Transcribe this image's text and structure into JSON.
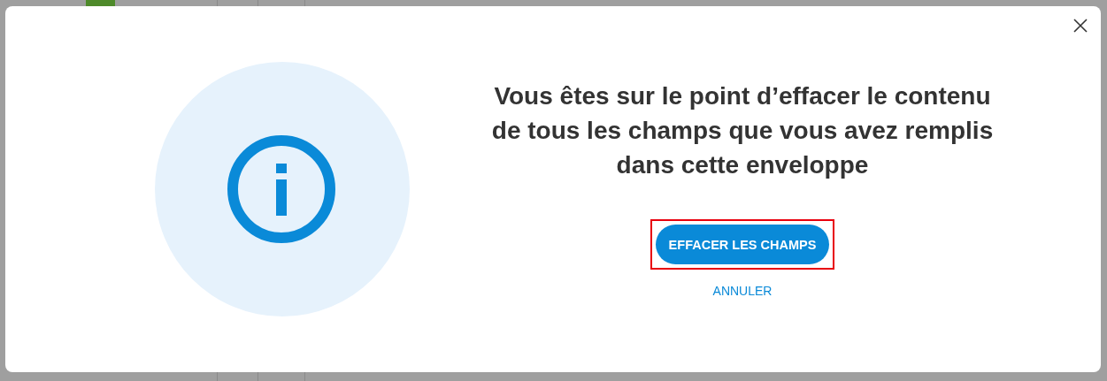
{
  "dialog": {
    "message": "Vous êtes sur le point d’effacer le contenu de tous les champs que vous avez remplis dans cette enveloppe",
    "confirm_button": {
      "label": "EFFACER LES CHAMPS",
      "highlighted": true
    },
    "cancel_link": "ANNULER"
  }
}
